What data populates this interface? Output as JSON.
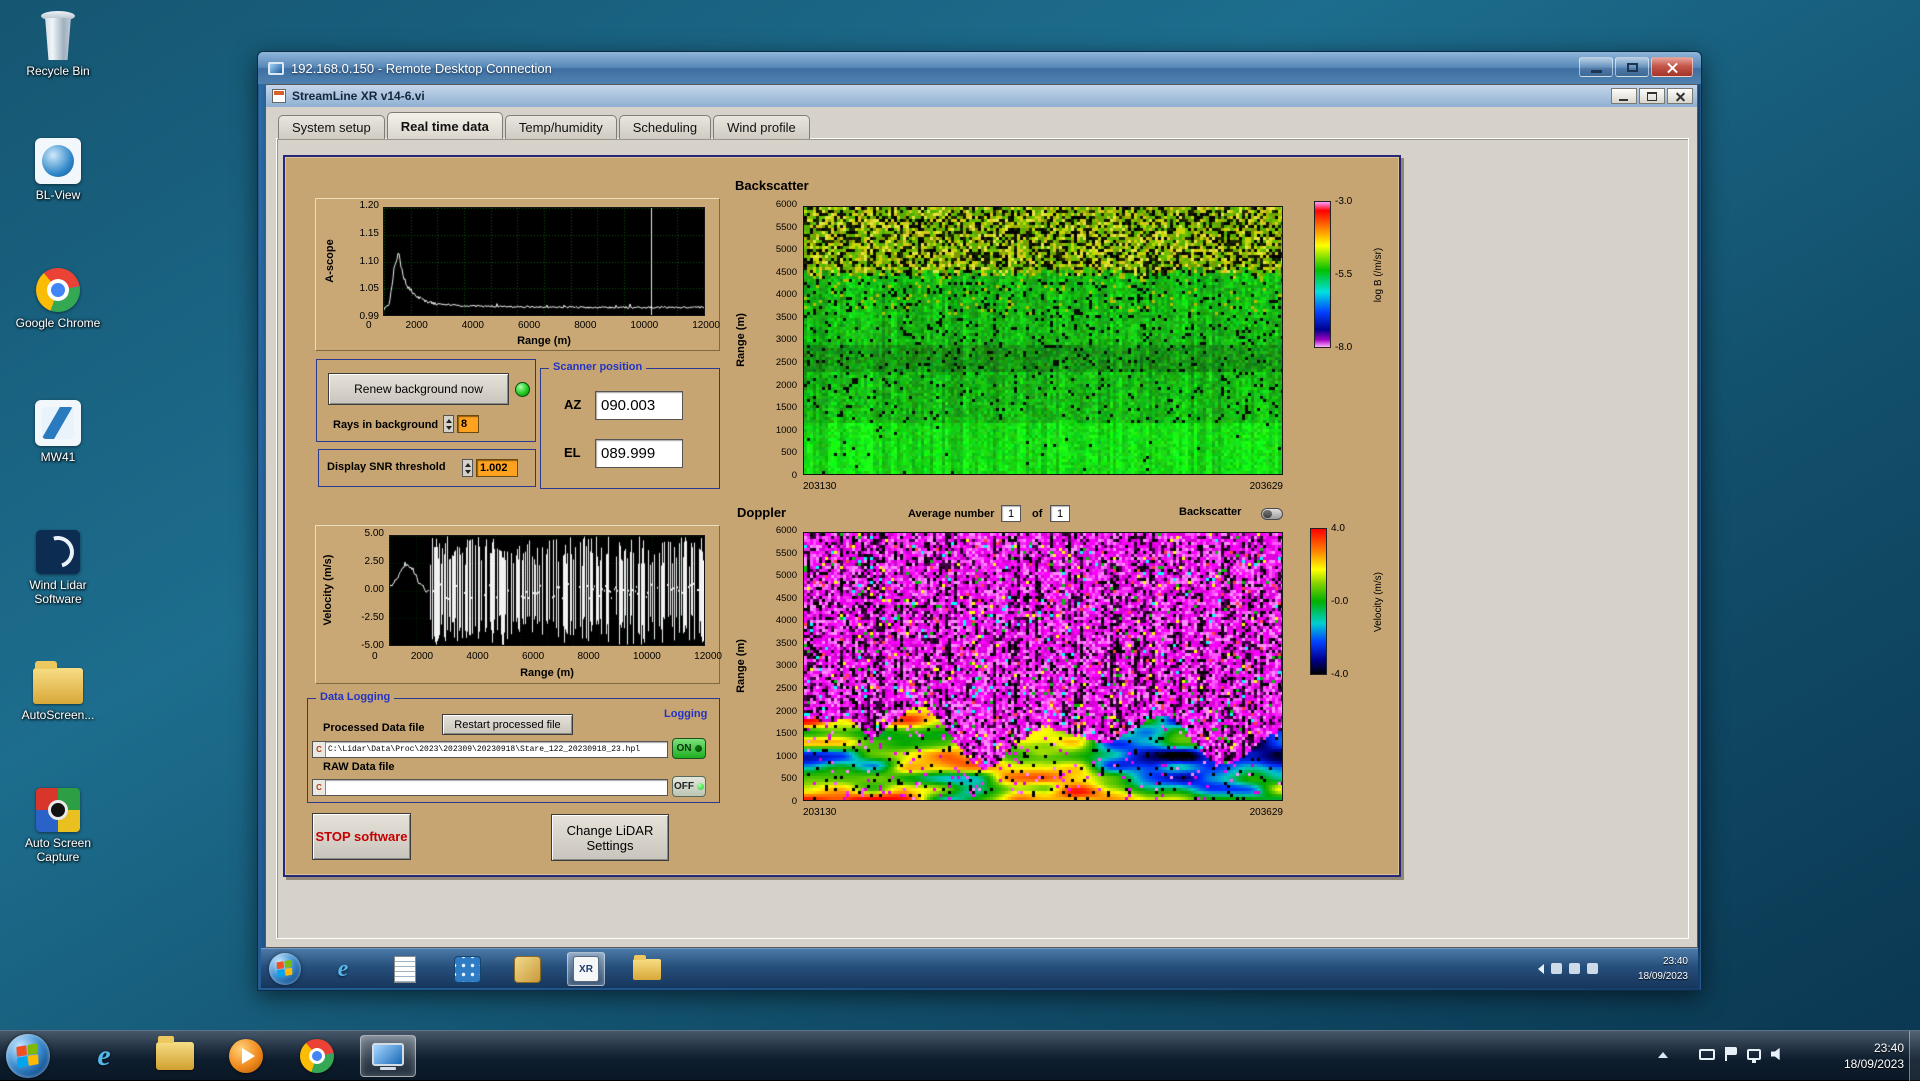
{
  "desktop": {
    "icons": [
      {
        "label": "Recycle Bin"
      },
      {
        "label": "BL-View"
      },
      {
        "label": "Google Chrome"
      },
      {
        "label": "MW41"
      },
      {
        "label": "Wind Lidar Software"
      },
      {
        "label": "AutoScreen..."
      },
      {
        "label": "Auto Screen Capture"
      }
    ]
  },
  "rdp_window": {
    "title": "192.168.0.150 - Remote Desktop Connection"
  },
  "app_window": {
    "title": "StreamLine XR v14-6.vi",
    "tabs": [
      {
        "label": "System setup"
      },
      {
        "label": "Real time data"
      },
      {
        "label": "Temp/humidity"
      },
      {
        "label": "Scheduling"
      },
      {
        "label": "Wind profile"
      }
    ]
  },
  "panel": {
    "renew_button": "Renew background now",
    "rays_label": "Rays in background",
    "rays_value": "8",
    "snr_label": "Display SNR threshold",
    "snr_value": "1.002",
    "scanner": {
      "title": "Scanner position",
      "az_label": "AZ",
      "az_value": "090.003",
      "el_label": "EL",
      "el_value": "089.999"
    },
    "average": {
      "label": "Average number",
      "value": "1",
      "of": "of",
      "total": "1"
    },
    "backscatter_toggle_label": "Backscatter",
    "data_logging": {
      "title": "Data Logging",
      "processed_label": "Processed Data file",
      "restart_button": "Restart processed file",
      "drive_letter": "C",
      "processed_path": "C:\\Lidar\\Data\\Proc\\2023\\202309\\20230918\\Stare_122_20230918_23.hpl",
      "on_label": "ON",
      "raw_label": "RAW Data file",
      "raw_path": "",
      "off_label": "OFF",
      "logging_label": "Logging"
    },
    "stop_button": "STOP software",
    "change_button": "Change LiDAR Settings"
  },
  "chart_data": [
    {
      "id": "a_scope",
      "type": "line",
      "title": "A-scope",
      "ylabel": "A-scope",
      "xlabel": "Range (m)",
      "xlim": [
        0,
        12000
      ],
      "ylim": [
        0.99,
        1.2
      ],
      "yticks": [
        "1.20",
        "1.15",
        "1.10",
        "1.05",
        "0.99"
      ],
      "xticks": [
        "0",
        "2000",
        "4000",
        "6000",
        "8000",
        "10000",
        "12000"
      ],
      "points": [
        [
          0,
          1.003
        ],
        [
          200,
          1.012
        ],
        [
          400,
          1.09
        ],
        [
          550,
          1.112
        ],
        [
          700,
          1.068
        ],
        [
          900,
          1.044
        ],
        [
          1200,
          1.028
        ],
        [
          1600,
          1.016
        ],
        [
          2200,
          1.011
        ],
        [
          3000,
          1.008
        ],
        [
          5000,
          1.006
        ],
        [
          8000,
          1.005
        ],
        [
          12000,
          1.005
        ]
      ],
      "noise": 0.004,
      "cursor_x": 10000,
      "grid": true
    },
    {
      "id": "velocity",
      "type": "line",
      "title": "Velocity",
      "ylabel": "Velocity (m/s)",
      "xlabel": "Range (m)",
      "xlim": [
        0,
        12000
      ],
      "ylim": [
        -5,
        5
      ],
      "yticks": [
        "5.00",
        "2.50",
        "0.00",
        "-2.50",
        "-5.00"
      ],
      "xticks": [
        "0",
        "2000",
        "4000",
        "6000",
        "8000",
        "10000",
        "12000"
      ],
      "points": [
        [
          0,
          0.2
        ],
        [
          300,
          1.3
        ],
        [
          600,
          2.5
        ],
        [
          900,
          1.8
        ],
        [
          1200,
          0.4
        ],
        [
          1450,
          -0.2
        ]
      ],
      "spike_start": 1500,
      "spike_density": 0.52,
      "spike_density_near": 0.75,
      "spike_amplitude": 5
    },
    {
      "id": "backscatter",
      "type": "heatmap",
      "title": "Backscatter",
      "ylabel": "Range (m)",
      "ylim": [
        0,
        6000
      ],
      "yticks": [
        "6000",
        "5500",
        "5000",
        "4500",
        "4000",
        "3500",
        "3000",
        "2500",
        "2000",
        "1500",
        "1000",
        "500",
        "0"
      ],
      "x_start_label": "203130",
      "x_end_label": "203629",
      "colorbar": {
        "label": "log B (/m/sr)",
        "ticks": [
          "-3.0",
          "-5.5",
          "-8.0"
        ],
        "min": -8.0,
        "max": -3.0
      },
      "description": "uniform green aerosol backscatter below ~4600 m, brighter green below 1200 m, speckled yellow/black noise band above 4600 m"
    },
    {
      "id": "doppler",
      "type": "heatmap",
      "title": "Doppler",
      "ylabel": "Range (m)",
      "ylim": [
        0,
        6000
      ],
      "yticks": [
        "6000",
        "5500",
        "5000",
        "4500",
        "4000",
        "3500",
        "3000",
        "2500",
        "2000",
        "1500",
        "1000",
        "500",
        "0"
      ],
      "x_start_label": "203130",
      "x_end_label": "203629",
      "colorbar": {
        "label": "Velocity (m/s)",
        "ticks": [
          "4.0",
          "-0.0",
          "-4.0"
        ],
        "min": -4.0,
        "max": 4.0
      },
      "description": "magenta aliased noise with dark vertical streaks above ~1800 m; coherent multicolour (green/yellow/red/blue) velocity field in the boundary layer below"
    }
  ],
  "remote_taskbar": {
    "clock_time": "23:40",
    "clock_date": "18/09/2023",
    "xr_icon_text": "XR",
    "ie_glyph": "e",
    "icons": [
      "start-orb",
      "internet-explorer",
      "notepad",
      "blue-app",
      "sticky-app",
      "streamline-xr",
      "folder"
    ]
  },
  "taskbar": {
    "clock_time": "23:40",
    "clock_date": "18/09/2023",
    "ie_glyph": "e",
    "icons": [
      "start-orb",
      "internet-explorer",
      "windows-explorer",
      "windows-media-player",
      "chrome",
      "remote-desktop"
    ]
  }
}
